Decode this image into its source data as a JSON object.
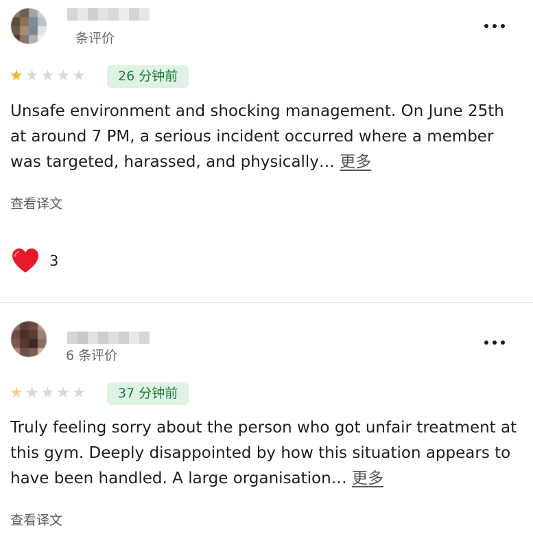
{
  "reviews": [
    {
      "review_count_label": "条评价",
      "rating": 1,
      "time_ago": "26 分钟前",
      "text": "Unsafe environment and shocking management. On June 25th at around 7 PM, a serious incident occurred where a member was targeted, harassed, and physically…",
      "more_label": "更多",
      "translate_label": "查看译文",
      "likes": "3"
    },
    {
      "review_count_label": "6 条评价",
      "rating": 1,
      "time_ago": "37 分钟前",
      "text": "Truly feeling sorry about the person who got unfair treatment at this gym. Deeply disappointed by how this situation appears to have been handled. A large organisation…",
      "more_label": "更多",
      "translate_label": "查看译文"
    }
  ],
  "colors": {
    "star_active": "#f0b41e",
    "star_inactive": "#d9d9d9",
    "badge_bg": "#dff3e4",
    "badge_text": "#1e7a3c",
    "heart": "#e8192c"
  },
  "icons": {
    "menu": "more-horizontal-icon",
    "like": "heart-icon",
    "star": "star-icon"
  }
}
